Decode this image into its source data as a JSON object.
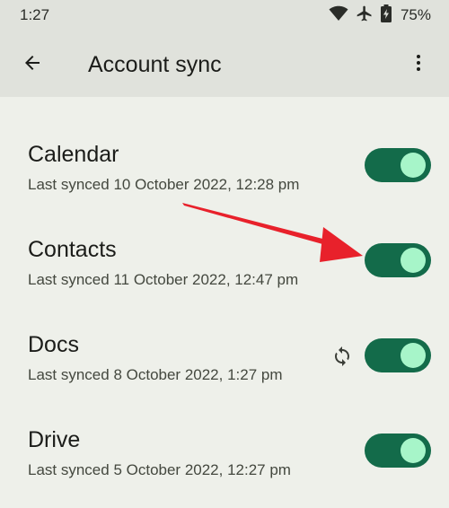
{
  "status_bar": {
    "time": "1:27",
    "battery_percent": "75%",
    "icons": [
      "wifi-icon",
      "airplane-icon",
      "battery-charging-icon"
    ]
  },
  "app_bar": {
    "title": "Account sync",
    "back_icon": "arrow-back-icon",
    "more_icon": "more-vert-icon"
  },
  "items": [
    {
      "title": "Calendar",
      "subtitle": "Last synced 10 October 2022, 12:28 pm",
      "enabled": true,
      "syncing": false
    },
    {
      "title": "Contacts",
      "subtitle": "Last synced 11 October 2022, 12:47 pm",
      "enabled": true,
      "syncing": false
    },
    {
      "title": "Docs",
      "subtitle": "Last synced 8 October 2022, 1:27 pm",
      "enabled": true,
      "syncing": true
    },
    {
      "title": "Drive",
      "subtitle": "Last synced 5 October 2022, 12:27 pm",
      "enabled": true,
      "syncing": false
    }
  ],
  "colors": {
    "toggle_track": "#136b4a",
    "toggle_thumb": "#a7f5c9",
    "annotation_arrow": "#e8212b"
  }
}
